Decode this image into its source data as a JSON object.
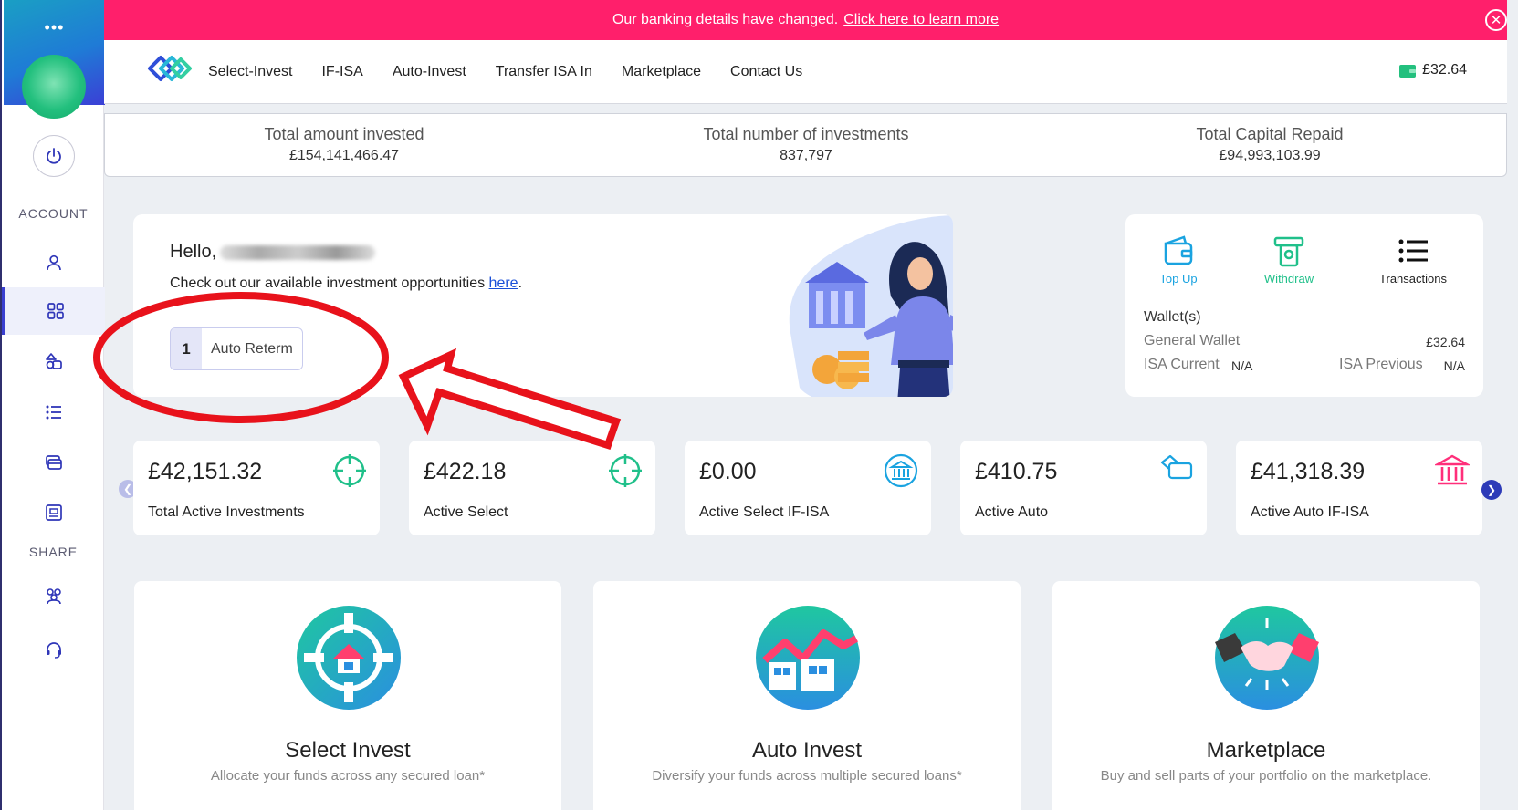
{
  "sidebar": {
    "menu_icon": "more-dots-icon",
    "section_account": "ACCOUNT",
    "section_share": "SHARE",
    "items": [
      {
        "name": "profile",
        "icon": "user-icon"
      },
      {
        "name": "dashboard",
        "icon": "grid-icon",
        "active": true
      },
      {
        "name": "portfolio",
        "icon": "shapes-icon"
      },
      {
        "name": "transactions-list",
        "icon": "list-icon"
      },
      {
        "name": "cards",
        "icon": "cards-icon"
      },
      {
        "name": "statements",
        "icon": "document-icon"
      },
      {
        "name": "refer",
        "icon": "people-icon"
      },
      {
        "name": "support",
        "icon": "headset-icon"
      }
    ]
  },
  "banner": {
    "text": "Our banking details have changed.",
    "link": "Click here to learn more"
  },
  "nav": {
    "links": [
      "Select-Invest",
      "IF-ISA",
      "Auto-Invest",
      "Transfer ISA In",
      "Marketplace",
      "Contact Us"
    ],
    "wallet_balance": "£32.64"
  },
  "stats": [
    {
      "label": "Total amount invested",
      "value": "£154,141,466.47"
    },
    {
      "label": "Total number of investments",
      "value": "837,797"
    },
    {
      "label": "Total Capital Repaid",
      "value": "£94,993,103.99"
    }
  ],
  "hello": {
    "greeting": "Hello,",
    "sub_text": "Check out our available investment opportunities",
    "sub_link": "here",
    "sub_end": ".",
    "badge_count": "1",
    "badge_label": "Auto Reterm"
  },
  "wallet": {
    "actions": [
      {
        "label": "Top Up",
        "color": "#1aa3e0",
        "icon": "wallet-icon"
      },
      {
        "label": "Withdraw",
        "color": "#20c08a",
        "icon": "atm-icon"
      },
      {
        "label": "Transactions",
        "color": "#222222",
        "icon": "list-icon"
      }
    ],
    "title": "Wallet(s)",
    "general_label": "General Wallet",
    "general_value": "£32.64",
    "isa_current_label": "ISA Current",
    "isa_current_value": "N/A",
    "isa_previous_label": "ISA Previous",
    "isa_previous_value": "N/A"
  },
  "kpis": [
    {
      "value": "£42,151.32",
      "label": "Total Active Investments",
      "icon": "target-icon",
      "color": "#20c08a"
    },
    {
      "value": "£422.18",
      "label": "Active Select",
      "icon": "target-icon",
      "color": "#20c08a"
    },
    {
      "value": "£0.00",
      "label": "Active Select IF-ISA",
      "icon": "bank-circle-icon",
      "color": "#1aa3e0"
    },
    {
      "value": "£410.75",
      "label": "Active Auto",
      "icon": "stacked-cards-icon",
      "color": "#1aa3e0"
    },
    {
      "value": "£41,318.39",
      "label": "Active Auto IF-ISA",
      "icon": "bank-icon",
      "color": "#ff2f7a"
    }
  ],
  "features": [
    {
      "title": "Select Invest",
      "subtitle": "Allocate your funds across any secured loan*",
      "icon": "house-target-icon"
    },
    {
      "title": "Auto Invest",
      "subtitle": "Diversify your funds across multiple secured loans*",
      "icon": "houses-chart-icon"
    },
    {
      "title": "Marketplace",
      "subtitle": "Buy and sell parts of your portfolio on the marketplace.",
      "icon": "handshake-icon"
    }
  ],
  "colors": {
    "banner": "#ff1f6b",
    "accent": "#3a3fd0",
    "annotation": "#e8121b"
  }
}
